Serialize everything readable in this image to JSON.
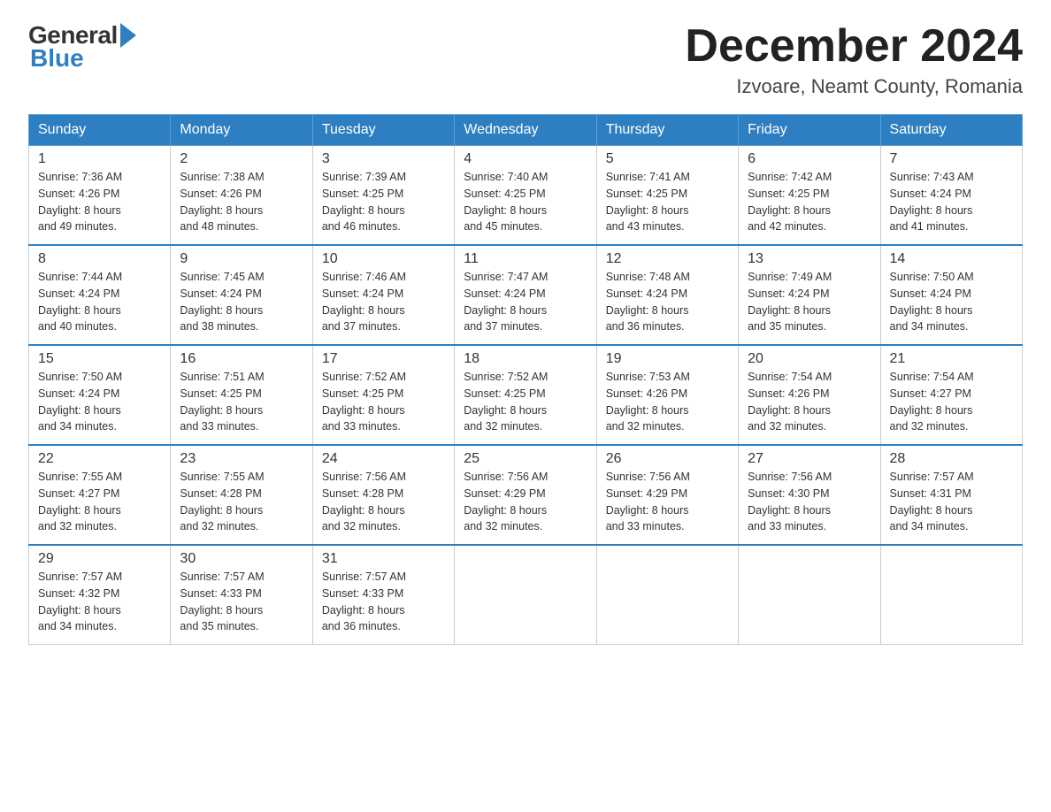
{
  "header": {
    "month_title": "December 2024",
    "location": "Izvoare, Neamt County, Romania",
    "logo_general": "General",
    "logo_blue": "Blue"
  },
  "weekdays": [
    "Sunday",
    "Monday",
    "Tuesday",
    "Wednesday",
    "Thursday",
    "Friday",
    "Saturday"
  ],
  "weeks": [
    [
      {
        "day": "1",
        "sunrise": "7:36 AM",
        "sunset": "4:26 PM",
        "daylight": "8 hours and 49 minutes."
      },
      {
        "day": "2",
        "sunrise": "7:38 AM",
        "sunset": "4:26 PM",
        "daylight": "8 hours and 48 minutes."
      },
      {
        "day": "3",
        "sunrise": "7:39 AM",
        "sunset": "4:25 PM",
        "daylight": "8 hours and 46 minutes."
      },
      {
        "day": "4",
        "sunrise": "7:40 AM",
        "sunset": "4:25 PM",
        "daylight": "8 hours and 45 minutes."
      },
      {
        "day": "5",
        "sunrise": "7:41 AM",
        "sunset": "4:25 PM",
        "daylight": "8 hours and 43 minutes."
      },
      {
        "day": "6",
        "sunrise": "7:42 AM",
        "sunset": "4:25 PM",
        "daylight": "8 hours and 42 minutes."
      },
      {
        "day": "7",
        "sunrise": "7:43 AM",
        "sunset": "4:24 PM",
        "daylight": "8 hours and 41 minutes."
      }
    ],
    [
      {
        "day": "8",
        "sunrise": "7:44 AM",
        "sunset": "4:24 PM",
        "daylight": "8 hours and 40 minutes."
      },
      {
        "day": "9",
        "sunrise": "7:45 AM",
        "sunset": "4:24 PM",
        "daylight": "8 hours and 38 minutes."
      },
      {
        "day": "10",
        "sunrise": "7:46 AM",
        "sunset": "4:24 PM",
        "daylight": "8 hours and 37 minutes."
      },
      {
        "day": "11",
        "sunrise": "7:47 AM",
        "sunset": "4:24 PM",
        "daylight": "8 hours and 37 minutes."
      },
      {
        "day": "12",
        "sunrise": "7:48 AM",
        "sunset": "4:24 PM",
        "daylight": "8 hours and 36 minutes."
      },
      {
        "day": "13",
        "sunrise": "7:49 AM",
        "sunset": "4:24 PM",
        "daylight": "8 hours and 35 minutes."
      },
      {
        "day": "14",
        "sunrise": "7:50 AM",
        "sunset": "4:24 PM",
        "daylight": "8 hours and 34 minutes."
      }
    ],
    [
      {
        "day": "15",
        "sunrise": "7:50 AM",
        "sunset": "4:24 PM",
        "daylight": "8 hours and 34 minutes."
      },
      {
        "day": "16",
        "sunrise": "7:51 AM",
        "sunset": "4:25 PM",
        "daylight": "8 hours and 33 minutes."
      },
      {
        "day": "17",
        "sunrise": "7:52 AM",
        "sunset": "4:25 PM",
        "daylight": "8 hours and 33 minutes."
      },
      {
        "day": "18",
        "sunrise": "7:52 AM",
        "sunset": "4:25 PM",
        "daylight": "8 hours and 32 minutes."
      },
      {
        "day": "19",
        "sunrise": "7:53 AM",
        "sunset": "4:26 PM",
        "daylight": "8 hours and 32 minutes."
      },
      {
        "day": "20",
        "sunrise": "7:54 AM",
        "sunset": "4:26 PM",
        "daylight": "8 hours and 32 minutes."
      },
      {
        "day": "21",
        "sunrise": "7:54 AM",
        "sunset": "4:27 PM",
        "daylight": "8 hours and 32 minutes."
      }
    ],
    [
      {
        "day": "22",
        "sunrise": "7:55 AM",
        "sunset": "4:27 PM",
        "daylight": "8 hours and 32 minutes."
      },
      {
        "day": "23",
        "sunrise": "7:55 AM",
        "sunset": "4:28 PM",
        "daylight": "8 hours and 32 minutes."
      },
      {
        "day": "24",
        "sunrise": "7:56 AM",
        "sunset": "4:28 PM",
        "daylight": "8 hours and 32 minutes."
      },
      {
        "day": "25",
        "sunrise": "7:56 AM",
        "sunset": "4:29 PM",
        "daylight": "8 hours and 32 minutes."
      },
      {
        "day": "26",
        "sunrise": "7:56 AM",
        "sunset": "4:29 PM",
        "daylight": "8 hours and 33 minutes."
      },
      {
        "day": "27",
        "sunrise": "7:56 AM",
        "sunset": "4:30 PM",
        "daylight": "8 hours and 33 minutes."
      },
      {
        "day": "28",
        "sunrise": "7:57 AM",
        "sunset": "4:31 PM",
        "daylight": "8 hours and 34 minutes."
      }
    ],
    [
      {
        "day": "29",
        "sunrise": "7:57 AM",
        "sunset": "4:32 PM",
        "daylight": "8 hours and 34 minutes."
      },
      {
        "day": "30",
        "sunrise": "7:57 AM",
        "sunset": "4:33 PM",
        "daylight": "8 hours and 35 minutes."
      },
      {
        "day": "31",
        "sunrise": "7:57 AM",
        "sunset": "4:33 PM",
        "daylight": "8 hours and 36 minutes."
      },
      null,
      null,
      null,
      null
    ]
  ],
  "labels": {
    "sunrise": "Sunrise: ",
    "sunset": "Sunset: ",
    "daylight": "Daylight: "
  }
}
